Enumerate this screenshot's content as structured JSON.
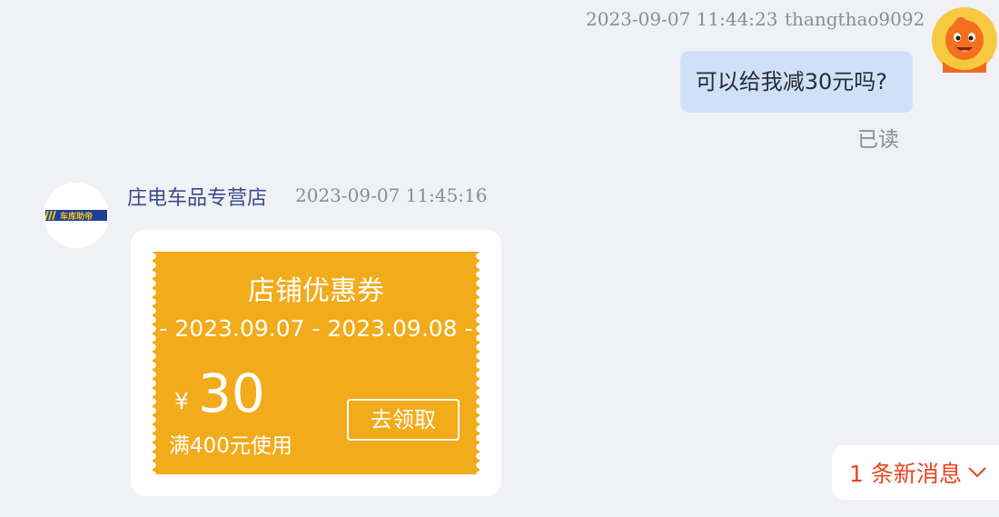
{
  "outgoing": {
    "timestamp": "2023-09-07 11:44:23",
    "username": "thangthao9092",
    "message": "可以给我减30元吗?",
    "status": "已读"
  },
  "incoming": {
    "shop_name": "庄电车品专营店",
    "timestamp": "2023-09-07 11:45:16",
    "shop_logo_text": "车库助帝"
  },
  "coupon": {
    "title": "店铺优惠券",
    "date_range": "2023.09.07 - 2023.09.08",
    "currency": "¥",
    "amount": "30",
    "condition": "满400元使用",
    "claim_label": "去领取"
  },
  "new_messages": {
    "label": "1 条新消息"
  },
  "colors": {
    "background": "#f0f1f5",
    "outgoing_bubble": "#cfe1f9",
    "coupon": "#f2ab1a",
    "shop_name": "#3c4a8e",
    "new_message_text": "#e8441f"
  },
  "icons": {
    "user_avatar": "orange-mascot-avatar-icon",
    "shop_avatar": "shop-logo-icon",
    "new_messages": "chevron-down-icon"
  }
}
